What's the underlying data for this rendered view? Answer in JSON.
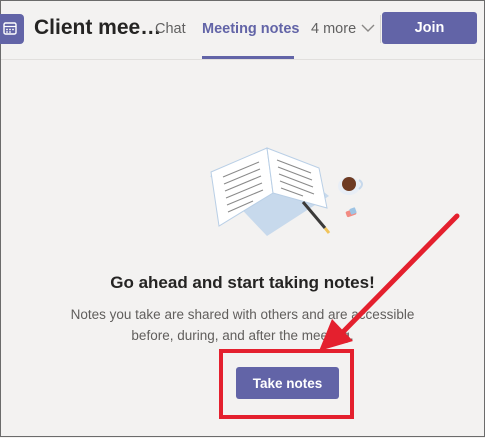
{
  "header": {
    "title": "Client mee…",
    "tabs": [
      {
        "label": "Chat",
        "active": false
      },
      {
        "label": "Meeting notes",
        "active": true
      }
    ],
    "more_label": "4 more",
    "join_label": "Join"
  },
  "main": {
    "heading": "Go ahead and start taking notes!",
    "description_line1": "Notes you take are shared with others and are accessible",
    "description_line2": "before, during, and after the meeting.",
    "take_notes_label": "Take notes"
  },
  "colors": {
    "accent": "#6264a7",
    "annotation": "#e4202e",
    "background": "#f3f2f1"
  }
}
